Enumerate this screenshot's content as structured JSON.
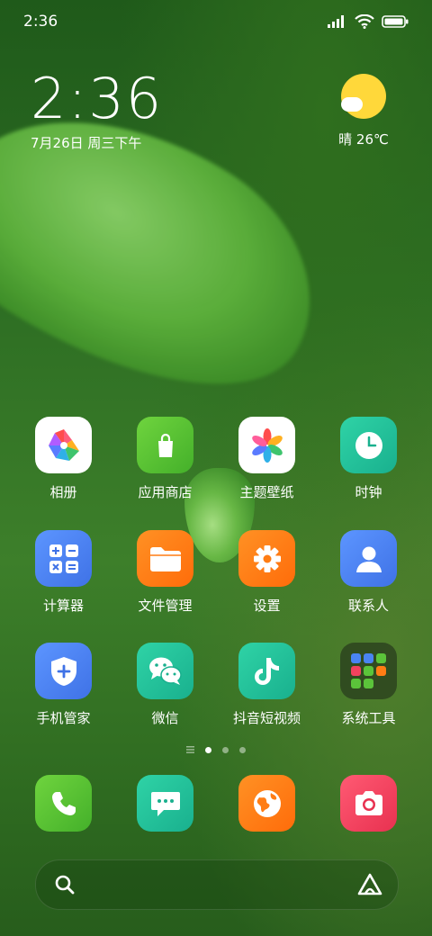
{
  "status_bar": {
    "time": "2:36",
    "icons": [
      "signal-icon",
      "wifi-icon",
      "battery-icon"
    ]
  },
  "clock_widget": {
    "time": "2:36",
    "date": "7月26日 周三下午"
  },
  "weather_widget": {
    "icon": "sunny-cloud-icon",
    "text": "晴 26℃"
  },
  "apps": [
    {
      "label": "相册",
      "icon": "gallery-icon",
      "bg": "#ffffff"
    },
    {
      "label": "应用商店",
      "icon": "app-store-icon",
      "bg": "#5bc43a"
    },
    {
      "label": "主题壁纸",
      "icon": "themes-icon",
      "bg": "#ffffff"
    },
    {
      "label": "时钟",
      "icon": "clock-icon",
      "bg": "#1fbf9a"
    },
    {
      "label": "计算器",
      "icon": "calculator-icon",
      "bg": "#4a84f2"
    },
    {
      "label": "文件管理",
      "icon": "folder-icon",
      "bg": "#ff7d14"
    },
    {
      "label": "设置",
      "icon": "gear-icon",
      "bg": "#ff7d14"
    },
    {
      "label": "联系人",
      "icon": "contacts-icon",
      "bg": "#4a84f2"
    },
    {
      "label": "手机管家",
      "icon": "shield-icon",
      "bg": "#4a84f2"
    },
    {
      "label": "微信",
      "icon": "chat-bubbles-icon",
      "bg": "#1fbf9a"
    },
    {
      "label": "抖音短视频",
      "icon": "music-note-icon",
      "bg": "#1fbf9a"
    },
    {
      "label": "系统工具",
      "icon": "folder-grid-icon",
      "bg": "#3c4a2c"
    }
  ],
  "page_indicator": {
    "count": 3,
    "active": 0
  },
  "dock": [
    {
      "icon": "phone-icon",
      "bg": "#5bc43a"
    },
    {
      "icon": "message-icon",
      "bg": "#1fbf9a"
    },
    {
      "icon": "browser-globe-icon",
      "bg": "#ff7d14"
    },
    {
      "icon": "camera-icon",
      "bg": "#f2425e"
    }
  ],
  "search_bar": {
    "left_icon": "search-icon",
    "right_icon": "assistant-icon"
  }
}
